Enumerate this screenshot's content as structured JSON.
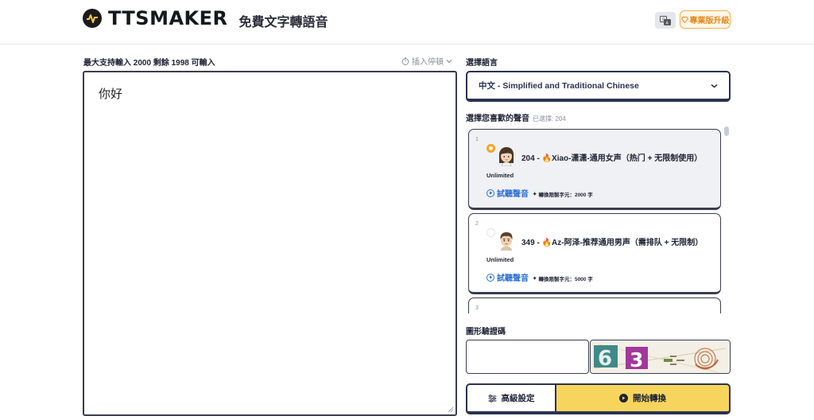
{
  "header": {
    "logo_text": "TTSMAKER",
    "subtitle": "免費文字轉語音",
    "pro_label": "專業版升級"
  },
  "editor": {
    "limit_label": "最大支持輸入 2000 剩餘 1998 可輸入",
    "pause_label": "插入停頓",
    "text": "你好"
  },
  "language": {
    "label": "選擇語言",
    "selected": "中文 - Simplified and Traditional Chinese"
  },
  "voices": {
    "label": "選擇您喜歡的聲音",
    "selected_count": "已選擇: 204",
    "items": [
      {
        "index": "1",
        "name": "204 - 🔥Xiao-潇潇-通用女声（热门 + 无限制使用）",
        "badge": "Unlimited",
        "play_label": "試聽聲音",
        "limit": "轉換限製字元：2000 字",
        "selected": true
      },
      {
        "index": "2",
        "name": "349 - 🔥Az-阿泽-推荐通用男声（需排队 + 无限制）",
        "badge": "Unlimited",
        "play_label": "試聽聲音",
        "limit": "轉換限製字元：5000 字",
        "selected": false
      },
      {
        "index": "3"
      }
    ]
  },
  "captcha": {
    "label": "圖形驗證碼"
  },
  "actions": {
    "advanced_label": "高級設定",
    "start_label": "開始轉換"
  },
  "colors": {
    "accent": "#f7d55c",
    "border": "#2a3250",
    "link": "#2d6fd6",
    "radio": "#f5a623"
  }
}
